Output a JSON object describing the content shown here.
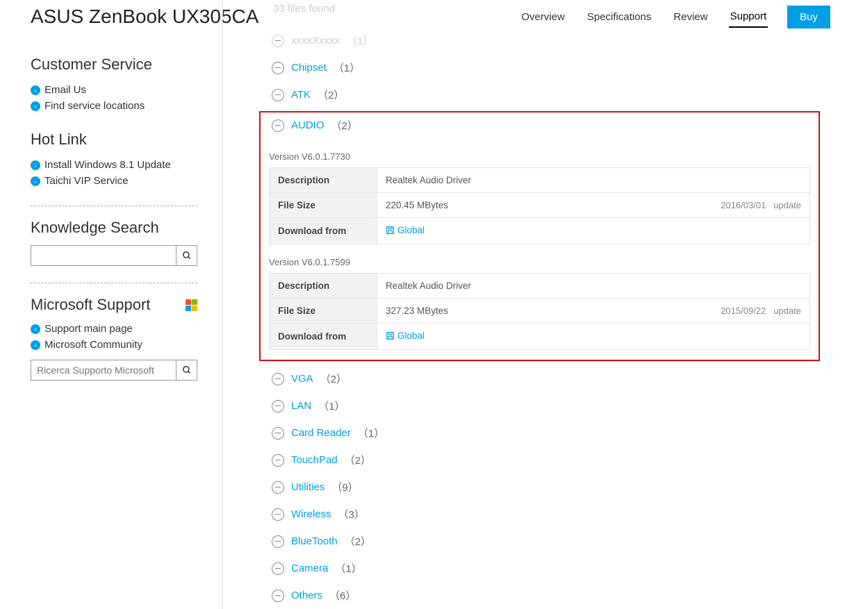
{
  "header": {
    "product_title": "ASUS ZenBook UX305CA",
    "nav": {
      "overview": "Overview",
      "specifications": "Specifications",
      "review": "Review",
      "support": "Support",
      "buy": "Buy"
    }
  },
  "sidebar": {
    "customer_service": {
      "heading": "Customer Service",
      "email": "Email Us",
      "locations": "Find service locations"
    },
    "hot_link": {
      "heading": "Hot Link",
      "win81": "Install Windows 8.1 Update",
      "taichi": "Taichi VIP Service"
    },
    "knowledge": {
      "heading": "Knowledge Search",
      "placeholder": ""
    },
    "microsoft": {
      "heading": "Microsoft Support",
      "main_page": "Support main page",
      "community": "Microsoft Community",
      "search_placeholder": "Ricerca Supporto Microsoft"
    }
  },
  "main": {
    "files_found": "33 files found",
    "labels": {
      "description": "Description",
      "file_size": "File Size",
      "download_from": "Download from",
      "global": "Global",
      "update": "update"
    },
    "categories": {
      "xxxx": {
        "label": "xxxxXxxxx",
        "count": "（1）",
        "muted": true
      },
      "chipset": {
        "label": "Chipset",
        "count": "（1）"
      },
      "atk": {
        "label": "ATK",
        "count": "（2）"
      },
      "audio": {
        "label": "AUDIO",
        "count": "（2）"
      },
      "vga": {
        "label": "VGA",
        "count": "（2）"
      },
      "lan": {
        "label": "LAN",
        "count": "（1）"
      },
      "card_reader": {
        "label": "Card Reader",
        "count": "（1）"
      },
      "touchpad": {
        "label": "TouchPad",
        "count": "（2）"
      },
      "utilities": {
        "label": "Utilities",
        "count": "（9）"
      },
      "wireless": {
        "label": "Wireless",
        "count": "（3）"
      },
      "bluetooth": {
        "label": "BlueTooth",
        "count": "（2）"
      },
      "camera": {
        "label": "Camera",
        "count": "（1）"
      },
      "others": {
        "label": "Others",
        "count": "（6）"
      }
    },
    "audio_drivers": [
      {
        "version": "Version V6.0.1.7730",
        "description": "Realtek Audio Driver",
        "file_size": "220.45 MBytes",
        "date": "2016/03/01"
      },
      {
        "version": "Version V6.0.1.7599",
        "description": "Realtek Audio Driver",
        "file_size": "327.23 MBytes",
        "date": "2015/09/22"
      }
    ]
  }
}
